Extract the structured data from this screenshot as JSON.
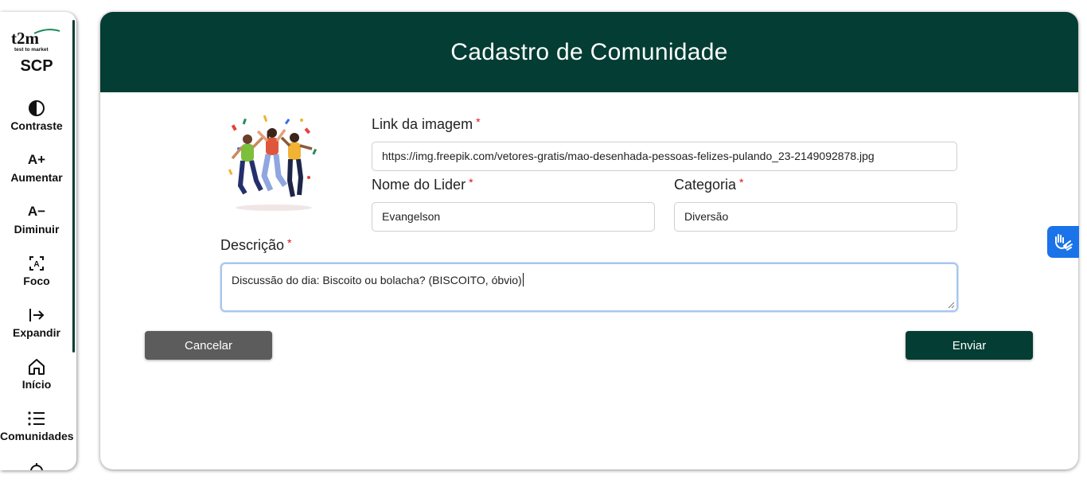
{
  "sidebar": {
    "logo_text": "t2m",
    "logo_subtext": "test to market",
    "app_name": "SCP",
    "items": [
      {
        "label": "Contraste",
        "icon": "contrast-icon"
      },
      {
        "label": "Aumentar",
        "icon": "font-increase-icon",
        "glyph": "A+"
      },
      {
        "label": "Diminuir",
        "icon": "font-decrease-icon",
        "glyph": "A−"
      },
      {
        "label": "Foco",
        "icon": "focus-icon"
      },
      {
        "label": "Expandir",
        "icon": "expand-icon"
      },
      {
        "label": "Início",
        "icon": "home-icon"
      },
      {
        "label": "Comunidades",
        "icon": "list-icon"
      }
    ]
  },
  "form": {
    "title": "Cadastro de Comunidade",
    "image_link": {
      "label": "Link da imagem",
      "required_mark": "*",
      "value": "https://img.freepik.com/vetores-gratis/mao-desenhada-pessoas-felizes-pulando_23-2149092878.jpg"
    },
    "leader_name": {
      "label": "Nome do Lider",
      "required_mark": "*",
      "value": "Evangelson"
    },
    "category": {
      "label": "Categoria",
      "required_mark": "*",
      "value": "Diversão"
    },
    "description": {
      "label": "Descrição",
      "required_mark": "*",
      "value": "Discussão do dia: Biscoito ou bolacha? (BISCOITO, óbvio)"
    },
    "cancel_label": "Cancelar",
    "submit_label": "Enviar"
  },
  "colors": {
    "primary": "#033d33",
    "cancel": "#5c5c5c",
    "accessibility_widget": "#1a73e8",
    "required": "#dd1111"
  },
  "accessibility_widget": {
    "icon": "sign-language-icon"
  }
}
